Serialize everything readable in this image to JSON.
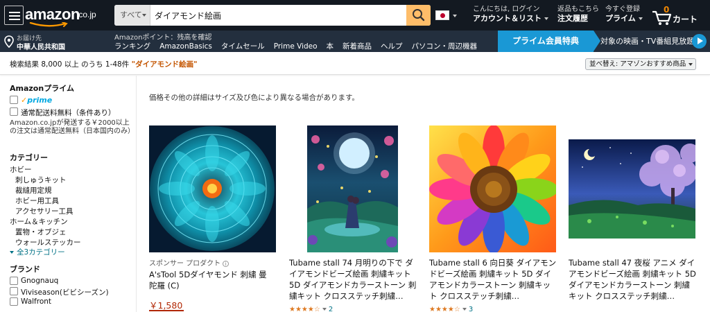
{
  "header": {
    "logo_text": "amazon",
    "logo_tld": ".co.jp",
    "search": {
      "category": "すべて",
      "value": "ダイアモンド絵画"
    },
    "account": {
      "greeting": "こんにちは, ログイン",
      "label": "アカウント＆リスト"
    },
    "orders": {
      "line1": "返品もこちら",
      "line2": "注文履歴"
    },
    "prime": {
      "line1": "今すぐ登録",
      "line2": "プライム"
    },
    "cart": {
      "count": "0",
      "label": "カート"
    }
  },
  "subnav": {
    "deliver_line1": "お届け先",
    "deliver_line2": "中華人民共和国",
    "points": "Amazonポイント：残高を確認",
    "links": [
      "ランキング",
      "AmazonBasics",
      "タイムセール",
      "Prime Video",
      "本",
      "新着商品",
      "ヘルプ",
      "パソコン・周辺機器"
    ],
    "prime_banner": "プライム会員特典",
    "prime_banner_right": "対象の映画・TV番組見放題"
  },
  "results": {
    "text": "検索結果 8,000 以上 のうち 1-48件",
    "query": "\"ダイアモンド絵画\"",
    "sort_label": "並べ替え: アマゾンおすすめ商品"
  },
  "sidebar": {
    "prime_heading": "Amazonプライム",
    "prime_logo_check": "✓",
    "prime_logo_text": "prime",
    "free_shipping": "通常配送料無料（条件あり）",
    "shipping_note": "Amazon.co.jpが発送する￥2000以上の注文は通常配送無料（日本国内のみ）",
    "category_heading": "カテゴリー",
    "categories": [
      {
        "label": "ホビー",
        "indent": false
      },
      {
        "label": "刺しゅうキット",
        "indent": true
      },
      {
        "label": "裁縫用定規",
        "indent": true
      },
      {
        "label": "ホビー用工具",
        "indent": true
      },
      {
        "label": "アクセサリー工具",
        "indent": true
      },
      {
        "label": "ホーム＆キッチン",
        "indent": false
      },
      {
        "label": "置物・オブジェ",
        "indent": true
      },
      {
        "label": "ウォールステッカー",
        "indent": true
      }
    ],
    "see_all": "全3カテゴリー",
    "brand_heading": "ブランド",
    "brands": [
      "Gnognauq",
      "Viviseason(ビビシーズン)",
      "Walfront"
    ]
  },
  "main": {
    "notice": "価格その他の詳細はサイズ及び色により異なる場合があります。",
    "products": [
      {
        "sponsored": "スポンサー プロダクト",
        "info_icon": "i",
        "title": "A'sTool 5Dダイヤモンド 刺繍 曼陀羅 (C)",
        "price": "￥1,580",
        "image": "teal-mandala"
      },
      {
        "title": "Tubame stall 74 月明りの下で ダイアモンドビーズ絵画 刺繍キット 5D ダイアモンドカラーストーン 刺繍キット クロスステッチ刺繍…",
        "stars": "★★★★☆",
        "rating_count": "2",
        "image": "moonlight-couple"
      },
      {
        "title": "Tubame stall 6 向日葵 ダイアモンドビーズ絵画 刺繍キット 5D ダイアモンドカラーストーン 刺繍キット クロスステッチ刺繍…",
        "stars": "★★★★☆",
        "rating_count": "3",
        "image": "sunflower"
      },
      {
        "title": "Tubame stall 47 夜桜 アニメ ダイアモンドビーズ絵画 刺繍キット 5D ダイアモンドカラーストーン 刺繍キット クロスステッチ刺繍…",
        "image": "night-cherry-blossom"
      }
    ]
  },
  "colors": {
    "nav_dark": "#131921",
    "nav_sub": "#232f3e",
    "search_button": "#febd69",
    "prime_blue": "#1a98d5",
    "price_red": "#b12704",
    "link_teal": "#007185",
    "query_orange": "#c45500",
    "star_orange": "#de7921"
  }
}
